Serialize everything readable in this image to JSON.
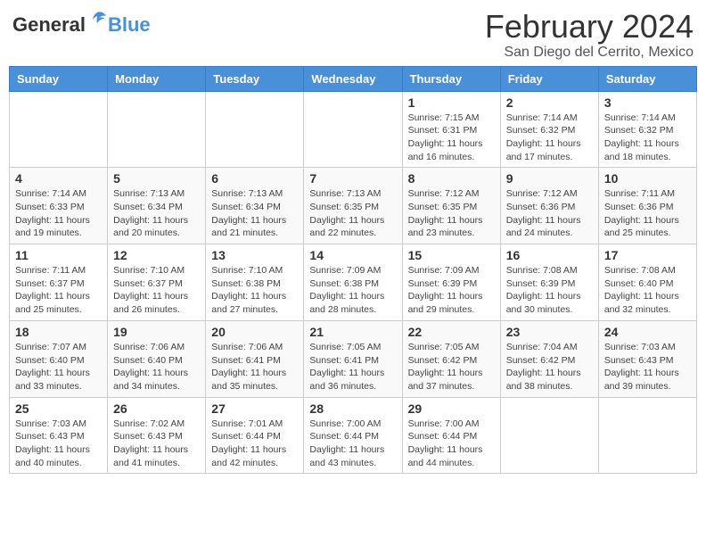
{
  "header": {
    "logo_general": "General",
    "logo_blue": "Blue",
    "main_title": "February 2024",
    "subtitle": "San Diego del Cerrito, Mexico"
  },
  "days_of_week": [
    "Sunday",
    "Monday",
    "Tuesday",
    "Wednesday",
    "Thursday",
    "Friday",
    "Saturday"
  ],
  "weeks": [
    [
      {
        "day": "",
        "info": ""
      },
      {
        "day": "",
        "info": ""
      },
      {
        "day": "",
        "info": ""
      },
      {
        "day": "",
        "info": ""
      },
      {
        "day": "1",
        "info": "Sunrise: 7:15 AM\nSunset: 6:31 PM\nDaylight: 11 hours and 16 minutes."
      },
      {
        "day": "2",
        "info": "Sunrise: 7:14 AM\nSunset: 6:32 PM\nDaylight: 11 hours and 17 minutes."
      },
      {
        "day": "3",
        "info": "Sunrise: 7:14 AM\nSunset: 6:32 PM\nDaylight: 11 hours and 18 minutes."
      }
    ],
    [
      {
        "day": "4",
        "info": "Sunrise: 7:14 AM\nSunset: 6:33 PM\nDaylight: 11 hours and 19 minutes."
      },
      {
        "day": "5",
        "info": "Sunrise: 7:13 AM\nSunset: 6:34 PM\nDaylight: 11 hours and 20 minutes."
      },
      {
        "day": "6",
        "info": "Sunrise: 7:13 AM\nSunset: 6:34 PM\nDaylight: 11 hours and 21 minutes."
      },
      {
        "day": "7",
        "info": "Sunrise: 7:13 AM\nSunset: 6:35 PM\nDaylight: 11 hours and 22 minutes."
      },
      {
        "day": "8",
        "info": "Sunrise: 7:12 AM\nSunset: 6:35 PM\nDaylight: 11 hours and 23 minutes."
      },
      {
        "day": "9",
        "info": "Sunrise: 7:12 AM\nSunset: 6:36 PM\nDaylight: 11 hours and 24 minutes."
      },
      {
        "day": "10",
        "info": "Sunrise: 7:11 AM\nSunset: 6:36 PM\nDaylight: 11 hours and 25 minutes."
      }
    ],
    [
      {
        "day": "11",
        "info": "Sunrise: 7:11 AM\nSunset: 6:37 PM\nDaylight: 11 hours and 25 minutes."
      },
      {
        "day": "12",
        "info": "Sunrise: 7:10 AM\nSunset: 6:37 PM\nDaylight: 11 hours and 26 minutes."
      },
      {
        "day": "13",
        "info": "Sunrise: 7:10 AM\nSunset: 6:38 PM\nDaylight: 11 hours and 27 minutes."
      },
      {
        "day": "14",
        "info": "Sunrise: 7:09 AM\nSunset: 6:38 PM\nDaylight: 11 hours and 28 minutes."
      },
      {
        "day": "15",
        "info": "Sunrise: 7:09 AM\nSunset: 6:39 PM\nDaylight: 11 hours and 29 minutes."
      },
      {
        "day": "16",
        "info": "Sunrise: 7:08 AM\nSunset: 6:39 PM\nDaylight: 11 hours and 30 minutes."
      },
      {
        "day": "17",
        "info": "Sunrise: 7:08 AM\nSunset: 6:40 PM\nDaylight: 11 hours and 32 minutes."
      }
    ],
    [
      {
        "day": "18",
        "info": "Sunrise: 7:07 AM\nSunset: 6:40 PM\nDaylight: 11 hours and 33 minutes."
      },
      {
        "day": "19",
        "info": "Sunrise: 7:06 AM\nSunset: 6:40 PM\nDaylight: 11 hours and 34 minutes."
      },
      {
        "day": "20",
        "info": "Sunrise: 7:06 AM\nSunset: 6:41 PM\nDaylight: 11 hours and 35 minutes."
      },
      {
        "day": "21",
        "info": "Sunrise: 7:05 AM\nSunset: 6:41 PM\nDaylight: 11 hours and 36 minutes."
      },
      {
        "day": "22",
        "info": "Sunrise: 7:05 AM\nSunset: 6:42 PM\nDaylight: 11 hours and 37 minutes."
      },
      {
        "day": "23",
        "info": "Sunrise: 7:04 AM\nSunset: 6:42 PM\nDaylight: 11 hours and 38 minutes."
      },
      {
        "day": "24",
        "info": "Sunrise: 7:03 AM\nSunset: 6:43 PM\nDaylight: 11 hours and 39 minutes."
      }
    ],
    [
      {
        "day": "25",
        "info": "Sunrise: 7:03 AM\nSunset: 6:43 PM\nDaylight: 11 hours and 40 minutes."
      },
      {
        "day": "26",
        "info": "Sunrise: 7:02 AM\nSunset: 6:43 PM\nDaylight: 11 hours and 41 minutes."
      },
      {
        "day": "27",
        "info": "Sunrise: 7:01 AM\nSunset: 6:44 PM\nDaylight: 11 hours and 42 minutes."
      },
      {
        "day": "28",
        "info": "Sunrise: 7:00 AM\nSunset: 6:44 PM\nDaylight: 11 hours and 43 minutes."
      },
      {
        "day": "29",
        "info": "Sunrise: 7:00 AM\nSunset: 6:44 PM\nDaylight: 11 hours and 44 minutes."
      },
      {
        "day": "",
        "info": ""
      },
      {
        "day": "",
        "info": ""
      }
    ]
  ]
}
